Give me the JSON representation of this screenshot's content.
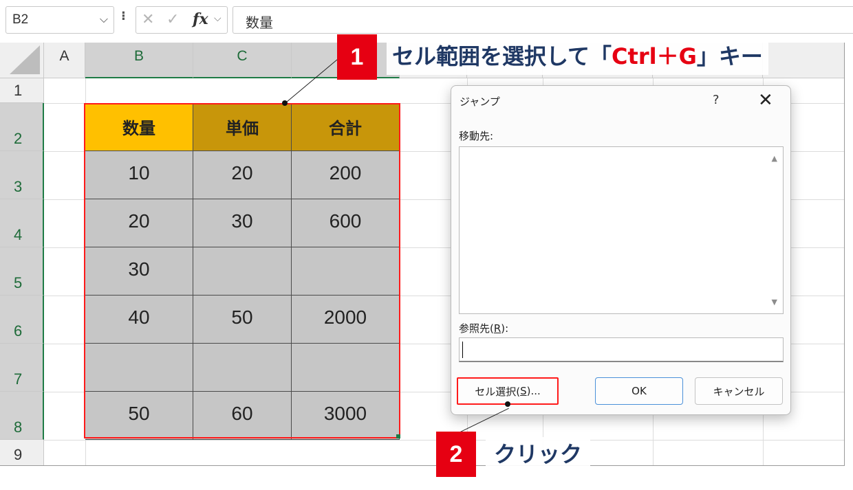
{
  "formula_bar": {
    "name_box": "B2",
    "name_box_arrow": "⌵",
    "dots": "⁝",
    "cancel_icon": "✕",
    "enter_icon": "✓",
    "fx_label": "fx",
    "fx_arrow": "⌵",
    "content": "数量"
  },
  "columns": [
    "A",
    "B",
    "C"
  ],
  "rows": [
    "1",
    "2",
    "3",
    "4",
    "5",
    "6",
    "7",
    "8",
    "9"
  ],
  "table": {
    "headers": [
      "数量",
      "単価",
      "合計"
    ],
    "rows": [
      [
        "10",
        "20",
        "200"
      ],
      [
        "20",
        "30",
        "600"
      ],
      [
        "30",
        "",
        ""
      ],
      [
        "40",
        "50",
        "2000"
      ],
      [
        "",
        "",
        ""
      ],
      [
        "50",
        "60",
        "3000"
      ]
    ]
  },
  "callout1": {
    "badge": "1",
    "text_prefix": "セル範囲を選択して「",
    "text_key": "Ctrl＋G",
    "text_suffix": "」キー"
  },
  "callout2": {
    "badge": "2",
    "text": "クリック"
  },
  "dialog": {
    "title": "ジャンプ",
    "help": "?",
    "close": "✕",
    "goto_label": "移動先:",
    "reference_label_pre": "参照先(",
    "reference_label_key": "R",
    "reference_label_post": "):",
    "reference_value": "",
    "special_button_pre": "セル選択(",
    "special_button_key": "S",
    "special_button_post": ")...",
    "ok_button": "OK",
    "cancel_button": "キャンセル",
    "scroll_up": "▲",
    "scroll_down": "▼"
  },
  "colors": {
    "header_yellow": "#ffc000",
    "header_gold": "#c8960a",
    "cell_gray": "#c6c6c6",
    "callout_red": "#e60012",
    "callout_navy": "#1f3864",
    "selection_green": "#1e7b45"
  }
}
